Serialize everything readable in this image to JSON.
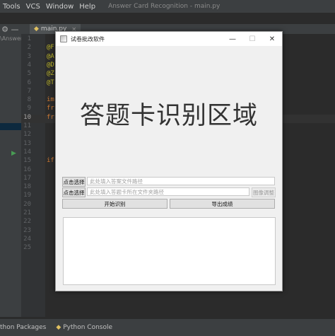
{
  "ide": {
    "menu": [
      "Tools",
      "VCS",
      "Window",
      "Help"
    ],
    "title": "Answer Card Recognition - main.py",
    "toolbar_icons": [
      "gear-icon",
      "minus-icon"
    ],
    "editor_tab": "main.py",
    "path_fragment": "\\Answer",
    "line_numbers": [
      "1",
      "2",
      "3",
      "4",
      "5",
      "6",
      "7",
      "8",
      "9",
      "10",
      "11",
      "12",
      "13",
      "14",
      "15",
      "16",
      "17",
      "18",
      "19",
      "20",
      "21",
      "22",
      "23",
      "24",
      "25"
    ],
    "code_fragments": [
      {
        "text": "@F",
        "color": "#bbb529"
      },
      {
        "text": "@A",
        "color": "#bbb529"
      },
      {
        "text": "@D",
        "color": "#bbb529"
      },
      {
        "text": "@Z",
        "color": "#bbb529"
      },
      {
        "text": "@T",
        "color": "#bbb529"
      },
      {
        "text": "im",
        "color": "#cc7832"
      },
      {
        "text": "fr",
        "color": "#cc7832"
      },
      {
        "text": "fr",
        "color": "#cc7832"
      },
      {
        "text": "if",
        "color": "#cc7832"
      }
    ],
    "bottom_tabs": [
      "thon Packages",
      "Python Console"
    ]
  },
  "app": {
    "window_title": "试卷批改软件",
    "window_controls": [
      "—",
      "☐",
      "✕"
    ],
    "image_placeholder": "答题卡识别区域",
    "select_answer_button": "点击选择",
    "answer_path_placeholder": "此处填入答案文件路径",
    "select_folder_button": "点击选择",
    "folder_path_placeholder": "此处填入答题卡所在文件夹路径",
    "image_adjust_button": "图像调整",
    "start_button": "开始识别",
    "export_button": "导出成绩"
  }
}
